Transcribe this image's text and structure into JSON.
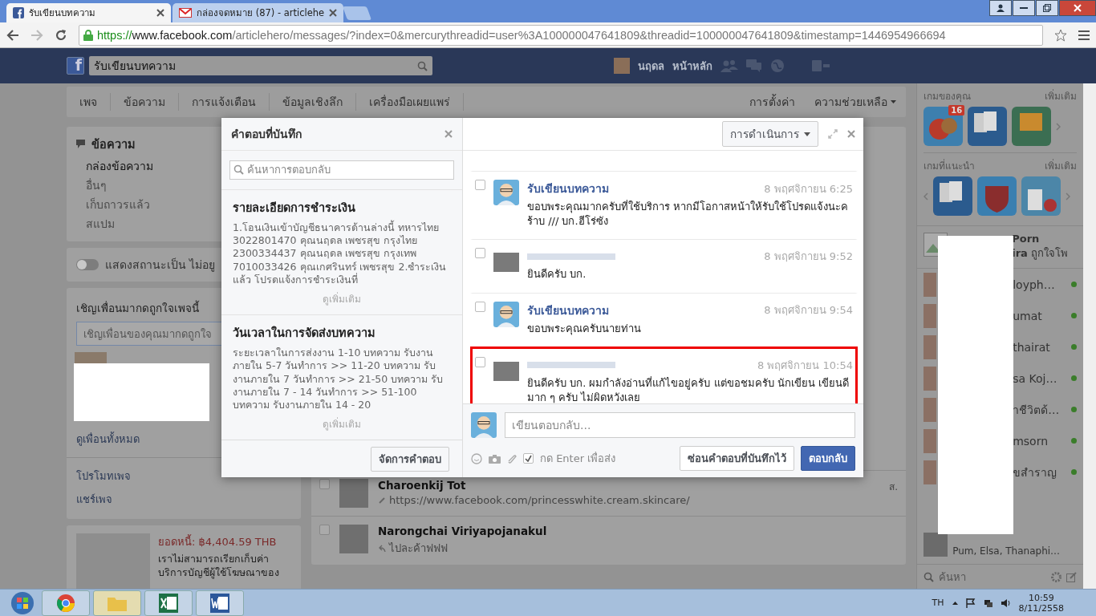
{
  "browser": {
    "tabs": [
      {
        "title": "รับเขียนบทความ",
        "kind": "facebook",
        "selected": true
      },
      {
        "title": "กล่องจดหมาย (87) - articlehe",
        "kind": "mail",
        "selected": false
      }
    ],
    "url_scheme": "https://",
    "url_host": "www.facebook.com",
    "url_path": "/articlehero/messages/?index=0&mercurythreadid=user%3A100000047641809&threadid=100000047641809&timestamp=1446954966694"
  },
  "topbar": {
    "logo": "f",
    "search_value": "รับเขียนบทความ",
    "user": "นฤดล",
    "home": "หน้าหลัก"
  },
  "page_nav": {
    "left": [
      "เพจ",
      "ข้อความ",
      "การแจ้งเตือน",
      "ข้อมูลเชิงลึก",
      "เครื่องมือเผยแพร่"
    ],
    "settings": "การตั้งค่า",
    "help": "ความช่วยเหลือ"
  },
  "messages_menu": {
    "title": "ข้อความ",
    "items": [
      {
        "label": "กล่องข้อความ",
        "selected": true
      },
      {
        "label": "อื่นๆ",
        "selected": false
      },
      {
        "label": "เก็บถาวรแล้ว",
        "selected": false
      },
      {
        "label": "สแปม",
        "selected": false
      }
    ]
  },
  "status_toggle": {
    "label": "แสดงสถานะเป็น ไม่อยู",
    "on": false
  },
  "invite": {
    "title": "เชิญเพื่อนมากดถูกใจเพจนี้",
    "placeholder": "เชิญเพื่อนของคุณมากดถูกใจ",
    "see_all": "ดูเพื่อนทั้งหมด"
  },
  "page_links": [
    "โปรโมทเพจ",
    "แชร์เพจ"
  ],
  "ad": {
    "balance": "ยอดหนี้: ฿4,404.59 THB",
    "text": "เราไม่สามารถเรียกเก็บค่าบริการบัญชีผู้ใช้โฆษณาของ"
  },
  "inbox_rows": [
    {
      "name": "Charoenkij Tot",
      "kind": "link",
      "snippet": "https://www.facebook.com/princesswhite.cream.skincare/",
      "time": "ส.",
      "checked": false
    },
    {
      "name": "Narongchai Viriyapojanakul",
      "kind": "reply",
      "snippet": "ไปละค้าฟฟฟ",
      "checked": false
    }
  ],
  "saved_replies": {
    "title": "คำตอบที่บันทึก",
    "search_placeholder": "ค้นหาการตอบกลับ",
    "items": [
      {
        "title": "รายละเอียดการชำระเงิน",
        "body": "1.โอนเงินเข้าบัญชีธนาคารด้านล่างนี้ ทหารไทย 3022801470 คุณนฤดล เพชรสุข กรุงไทย 2300334437 คุณนฤดล เพชรสุข กรุงเทพ 7010033426 คุณเกศรินทร์ เพชรสุข 2.ชำระเงินแล้ว โปรดแจ้งการชำระเงินที่",
        "more": "ดูเพิ่มเติม"
      },
      {
        "title": "วันเวลาในการจัดส่งบทความ",
        "body": "ระยะเวลาในการส่งงาน 1-10 บทความ รับงานภายใน 5-7 วันทำการ >> 11-20 บทความ รับงานภายใน 7 วันทำการ >> 21-50 บทความ รับงานภายใน 7 - 14 วันทำการ >> 51-100 บทความ รับงานภายใน 14 - 20",
        "more": "ดูเพิ่มเติม"
      }
    ],
    "manage": "จัดการคำตอบ"
  },
  "conversation": {
    "actions": "การดำเนินการ",
    "messages": [
      {
        "kind": "page",
        "sender": "รับเขียนบทความ",
        "time": "8 พฤศจิกายน 6:25",
        "text": "ขอบพระคุณมากครับที่ใช้บริการ หากมีโอกาสหน้าให้รับใช้โปรดแจ้งนะคร้าบ /// บก.ฮีโร่ซัง",
        "checked": false,
        "highlighted": false
      },
      {
        "kind": "friend",
        "time": "8 พฤศจิกายน 9:52",
        "text": "ยินดีครับ บก.",
        "checked": false,
        "highlighted": false
      },
      {
        "kind": "page",
        "sender": "รับเขียนบทความ",
        "time": "8 พฤศจิกายน 9:54",
        "text": "ขอบพระคุณครับนายท่าน",
        "checked": false,
        "highlighted": false
      },
      {
        "kind": "friend",
        "time": "8 พฤศจิกายน 10:54",
        "text": "ยินดีครับ บก. ผมกำลังอ่านที่แก้ไขอยู่ครับ แต่ขอชมครับ นักเขียน เขียนดีมาก ๆ ครับ ไม่ผิดหวังเลย",
        "checked": false,
        "highlighted": true
      }
    ],
    "reply_placeholder": "เขียนตอบกลับ...",
    "enter_to_send": {
      "label": "กด Enter เพื่อส่ง",
      "checked": true
    },
    "hide_button": "ซ่อนคำตอบที่บันทึกไว้",
    "reply_button": "ตอบกลับ"
  },
  "sidebar": {
    "your_games": "เกมของคุณ",
    "your_games_more": "เพิ่มเติม",
    "game_badge": "16",
    "suggested": "เกมที่แนะนำ",
    "suggested_more": "เพิ่มเติม",
    "story": [
      "Porn",
      "**ira** ถูกใจโพ"
    ],
    "friends": [
      {
        "name": "loyph…",
        "online": true
      },
      {
        "name": "umat",
        "online": true
      },
      {
        "name": "thairat",
        "online": true
      },
      {
        "name": "sa Koj…",
        "online": true
      },
      {
        "name": "าชีวิตด้…",
        "online": true
      },
      {
        "name": "msorn",
        "online": true
      },
      {
        "name": "ขสำราญ",
        "online": true
      }
    ],
    "group": "Pum, Elsa, Thanaphi…",
    "search": "ค้นหา"
  },
  "taskbar": {
    "lang": "TH",
    "time": "10:59",
    "date": "8/11/2558"
  }
}
